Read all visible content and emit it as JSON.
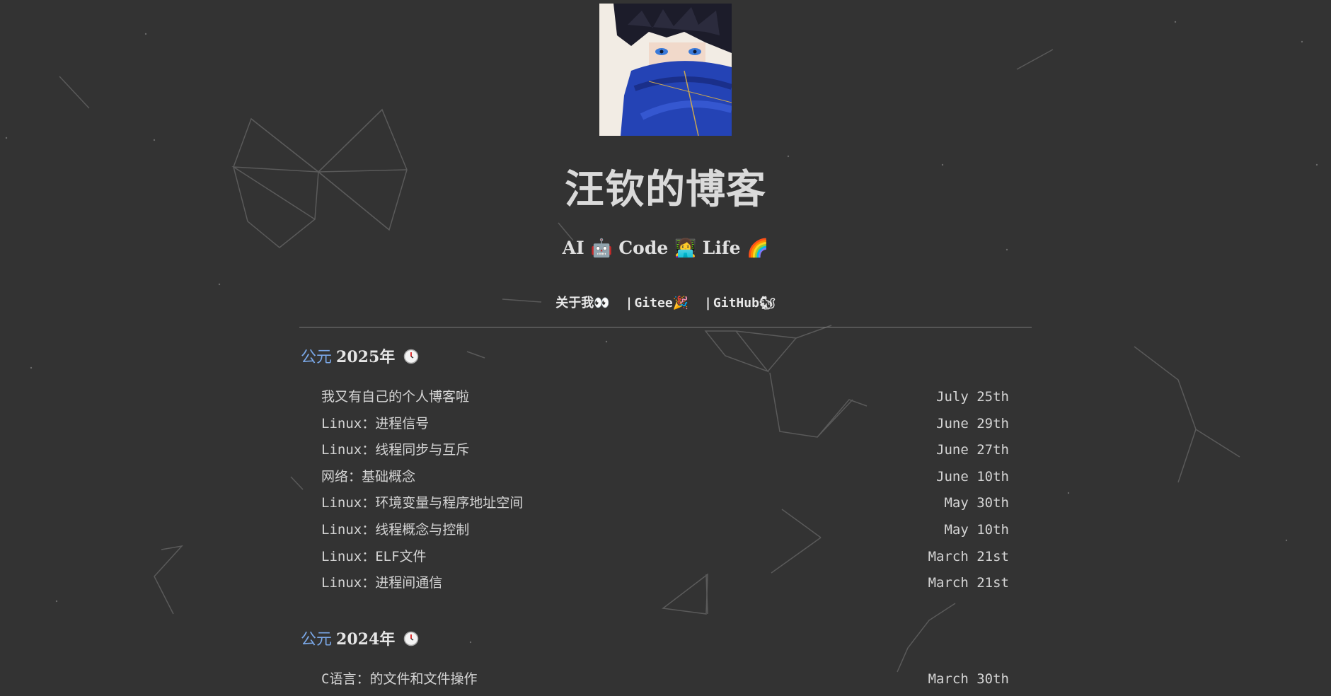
{
  "site": {
    "title": "汪钦的博客",
    "tagline": "AI 🤖 Code 👩‍💻 Life 🌈"
  },
  "nav": {
    "about": "关于我👀",
    "gitee": "Gitee🎉",
    "github": "GitHub🐿",
    "separator": "|"
  },
  "archive": [
    {
      "era": "公元",
      "year": "2025年",
      "icon": "clock-icon",
      "posts": [
        {
          "title": "我又有自己的个人博客啦",
          "date": "July 25th"
        },
        {
          "title": "Linux：进程信号",
          "date": "June 29th"
        },
        {
          "title": "Linux：线程同步与互斥",
          "date": "June 27th"
        },
        {
          "title": "网络：基础概念",
          "date": "June 10th"
        },
        {
          "title": "Linux：环境变量与程序地址空间",
          "date": "May 30th"
        },
        {
          "title": "Linux：线程概念与控制",
          "date": "May 10th"
        },
        {
          "title": "Linux：ELF文件",
          "date": "March 21st"
        },
        {
          "title": "Linux：进程间通信",
          "date": "March 21st"
        }
      ]
    },
    {
      "era": "公元",
      "year": "2024年",
      "icon": "clock-icon",
      "posts": [
        {
          "title": "C语言：的文件和文件操作",
          "date": "March 30th"
        }
      ]
    }
  ],
  "colors": {
    "background": "#333333",
    "era_accent": "#7aa7e6",
    "text": "#d4d4d4"
  }
}
